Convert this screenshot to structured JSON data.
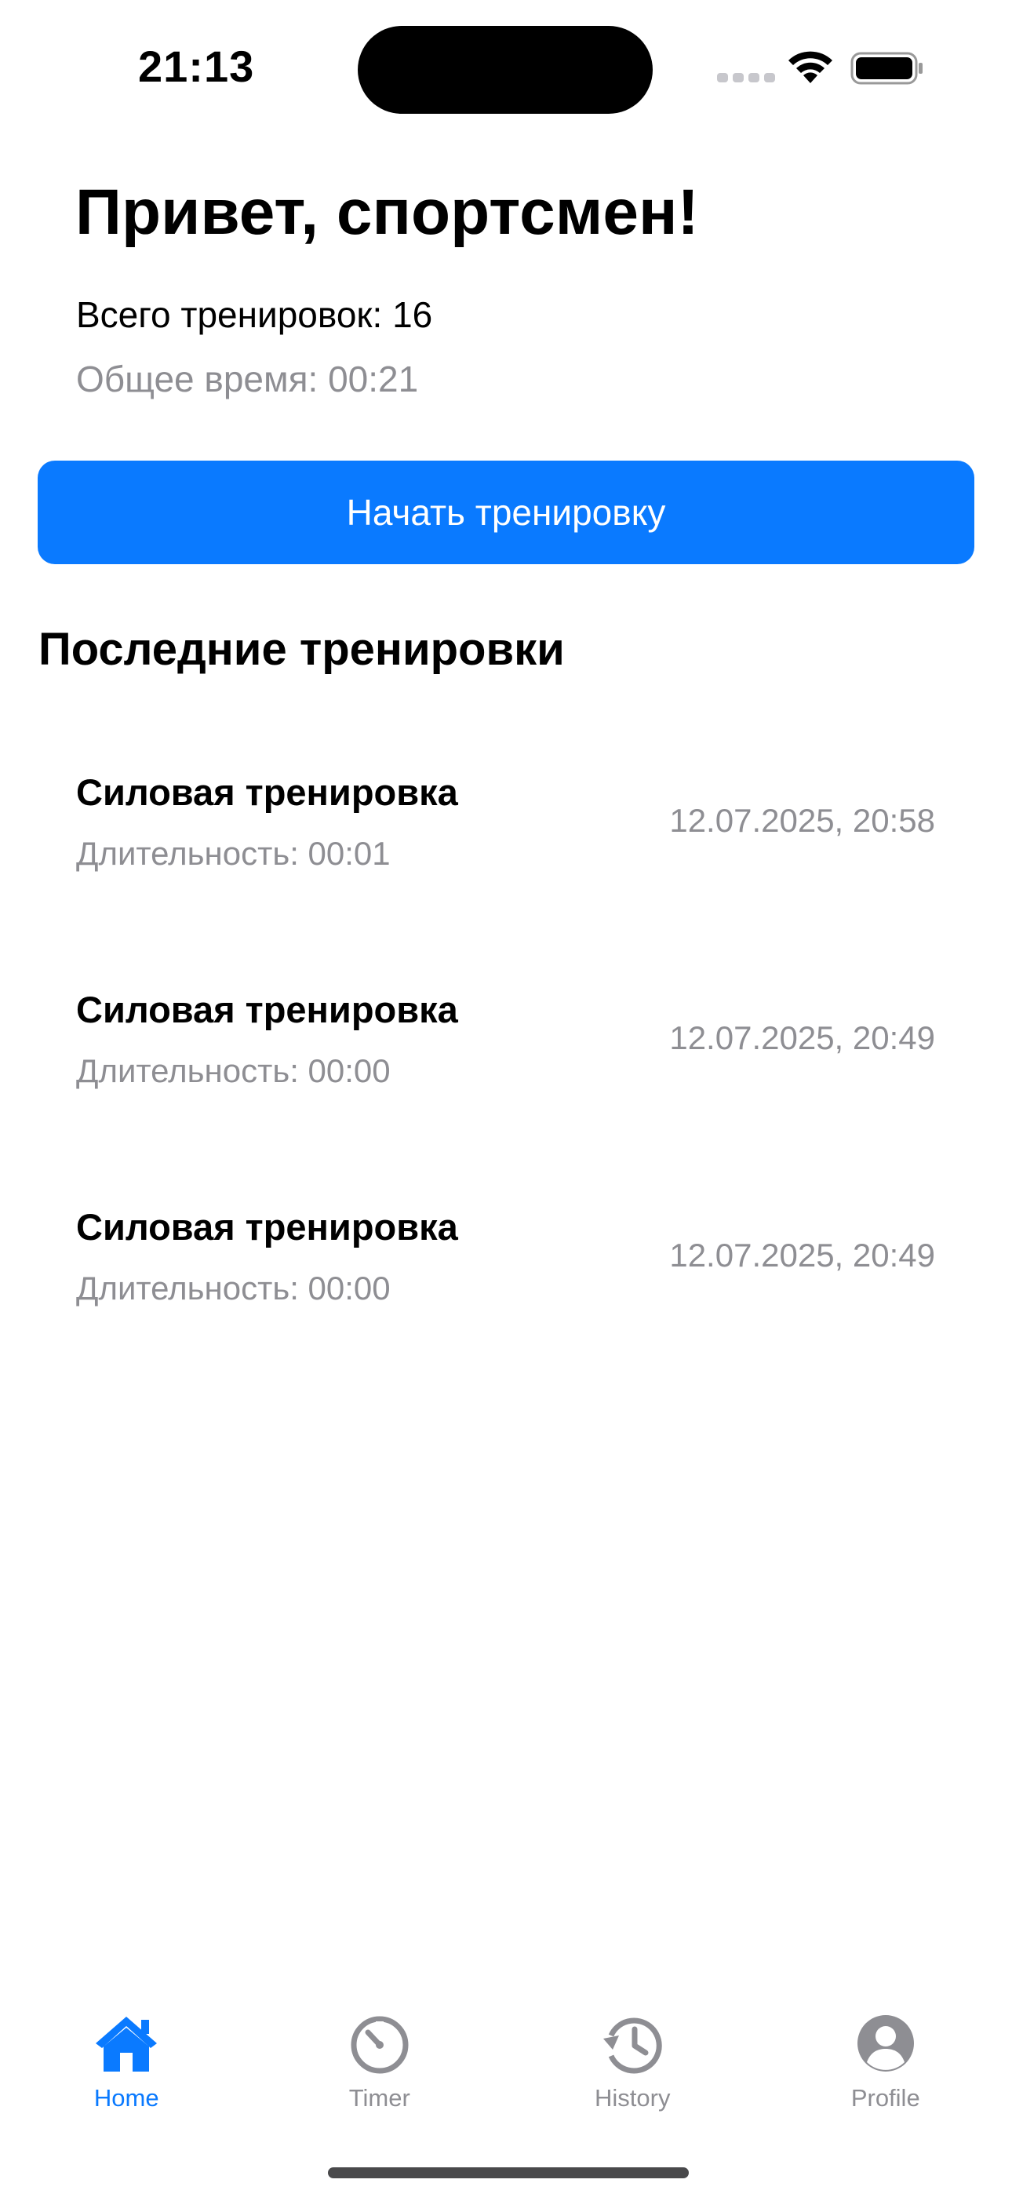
{
  "status_bar": {
    "time": "21:13"
  },
  "header": {
    "greeting": "Привет, спортсмен!",
    "total_workouts": "Всего тренировок: 16",
    "total_time": "Общее время: 00:21"
  },
  "start_button": {
    "label": "Начать тренировку"
  },
  "recent": {
    "title": "Последние тренировки",
    "items": [
      {
        "name": "Силовая тренировка",
        "duration": "Длительность: 00:01",
        "date": "12.07.2025, 20:58"
      },
      {
        "name": "Силовая тренировка",
        "duration": "Длительность: 00:00",
        "date": "12.07.2025, 20:49"
      },
      {
        "name": "Силовая тренировка",
        "duration": "Длительность: 00:00",
        "date": "12.07.2025, 20:49"
      }
    ]
  },
  "tab_bar": {
    "tabs": [
      {
        "label": "Home",
        "icon": "house-fill-icon",
        "active": true
      },
      {
        "label": "Timer",
        "icon": "timer-icon",
        "active": false
      },
      {
        "label": "History",
        "icon": "history-clock-icon",
        "active": false
      },
      {
        "label": "Profile",
        "icon": "person-circle-icon",
        "active": false
      }
    ]
  },
  "colors": {
    "accent": "#0a7aff",
    "secondary_text": "#8e8e93",
    "inactive_tab": "#8e8e93"
  }
}
